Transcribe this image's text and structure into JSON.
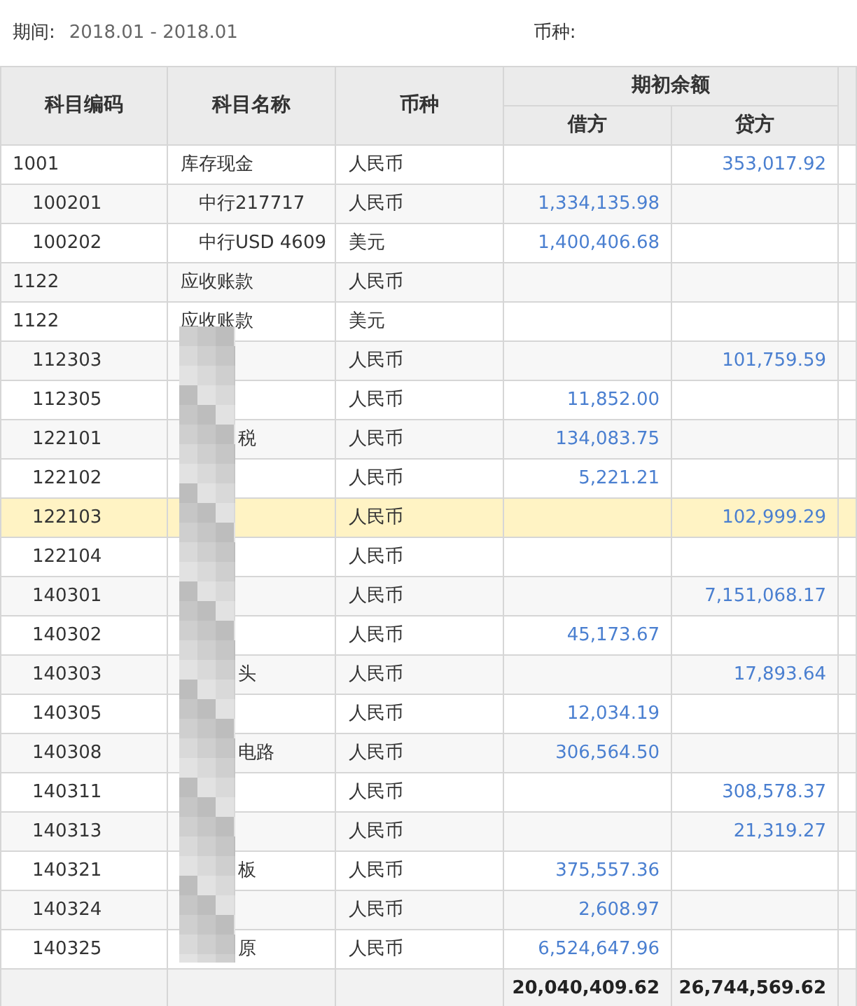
{
  "filters": {
    "period_label": "期间:",
    "period_value": "2018.01 - 2018.01",
    "currency_label": "币种:"
  },
  "table": {
    "columns": {
      "code": "科目编码",
      "name": "科目名称",
      "currency": "币种",
      "group": "期初余额",
      "debit": "借方",
      "credit": "贷方"
    },
    "rows": [
      {
        "code": "1001",
        "name": "库存现金",
        "currency": "人民币",
        "credit": "353,017.92",
        "selected": false,
        "children": [
          {
            "code": "100201",
            "name": "中行217717",
            "currency": "人民币",
            "debit": "1,334,135.98",
            "selected": false
          },
          {
            "code": "100202",
            "name": "中行USD 4609",
            "currency": "美元",
            "debit": "1,400,406.68",
            "selected": false
          }
        ]
      },
      {
        "code": "1122",
        "name": "应收账款",
        "currency": "人民币",
        "selected": false
      },
      {
        "code": "1122",
        "name": "应收账款",
        "currency": "美元",
        "selected": false,
        "children": [
          {
            "code": "112303",
            "currency": "人民币",
            "credit": "101,759.59",
            "selected": false
          },
          {
            "code": "112305",
            "currency": "人民币",
            "debit": "11,852.00",
            "selected": false
          },
          {
            "code": "122101",
            "name": "税",
            "currency": "人民币",
            "debit": "134,083.75",
            "selected": false
          },
          {
            "code": "122102",
            "currency": "人民币",
            "debit": "5,221.21",
            "selected": false
          },
          {
            "code": "122103",
            "currency": "人民币",
            "credit": "102,999.29",
            "selected": true
          },
          {
            "code": "122104",
            "currency": "人民币",
            "selected": false
          },
          {
            "code": "140301",
            "currency": "人民币",
            "credit": "7,151,068.17",
            "selected": false
          },
          {
            "code": "140302",
            "currency": "人民币",
            "debit": "45,173.67",
            "selected": false
          },
          {
            "code": "140303",
            "name": "头",
            "currency": "人民币",
            "credit": "17,893.64",
            "selected": false
          },
          {
            "code": "140305",
            "currency": "人民币",
            "debit": "12,034.19",
            "selected": false
          },
          {
            "code": "140308",
            "name": "电路",
            "currency": "人民币",
            "debit": "306,564.50",
            "selected": false
          },
          {
            "code": "140311",
            "currency": "人民币",
            "credit": "308,578.37",
            "selected": false
          },
          {
            "code": "140313",
            "currency": "人民币",
            "credit": "21,319.27",
            "selected": false
          },
          {
            "code": "140321",
            "name": "板",
            "currency": "人民币",
            "debit": "375,557.36",
            "selected": false
          },
          {
            "code": "140324",
            "currency": "人民币",
            "debit": "2,608.97",
            "selected": false
          },
          {
            "code": "140325",
            "name": "原",
            "currency": "人民币",
            "debit": "6,524,647.96",
            "selected": false
          }
        ]
      }
    ],
    "totals": {
      "debit": "20,040,409.62",
      "credit": "26,744,569.62"
    }
  }
}
